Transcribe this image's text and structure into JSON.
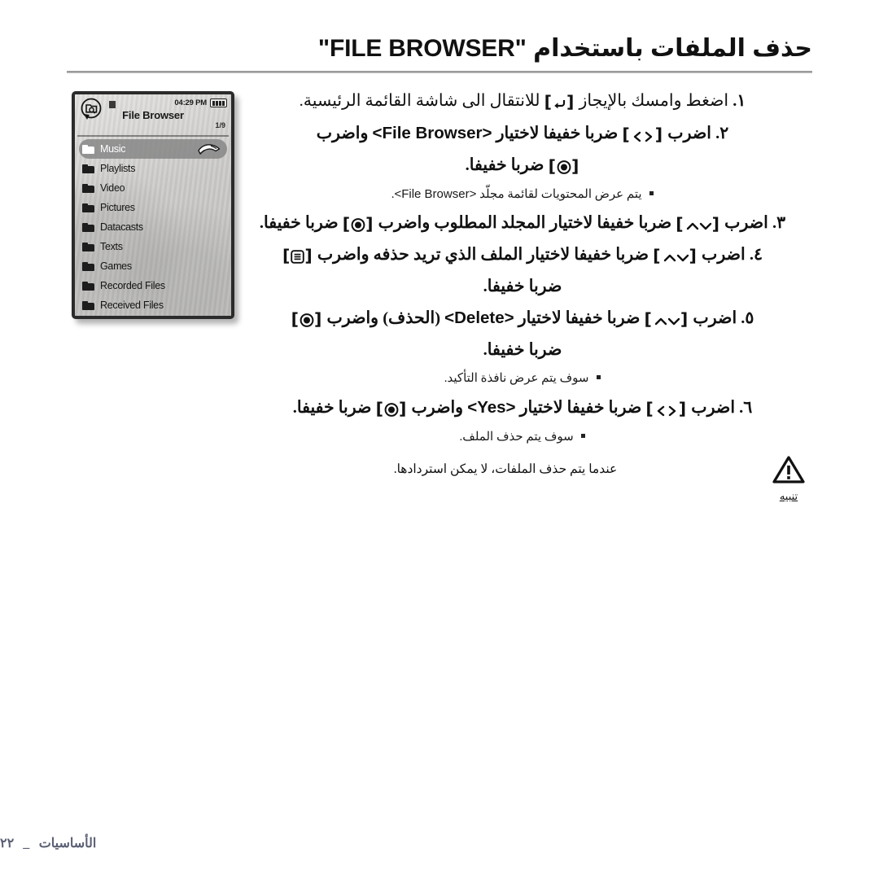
{
  "page": {
    "title": "حذف الملفات باستخدام \"FILE BROWSER\"",
    "direction": "rtl"
  },
  "device": {
    "status": {
      "time": "04:29 PM",
      "battery_icon": "battery-full-icon",
      "badge_icon": "folder-search-badge-icon",
      "marker_icon": "square-marker-icon"
    },
    "screen_title": "File Browser",
    "page_indicator": "1/9",
    "items": [
      {
        "label": "Music",
        "selected": true,
        "icon": "folder-icon",
        "accessory": "hand-pointer-icon"
      },
      {
        "label": "Playlists",
        "selected": false,
        "icon": "folder-icon"
      },
      {
        "label": "Video",
        "selected": false,
        "icon": "folder-icon"
      },
      {
        "label": "Pictures",
        "selected": false,
        "icon": "folder-icon"
      },
      {
        "label": "Datacasts",
        "selected": false,
        "icon": "folder-icon"
      },
      {
        "label": "Texts",
        "selected": false,
        "icon": "folder-icon"
      },
      {
        "label": "Games",
        "selected": false,
        "icon": "folder-icon"
      },
      {
        "label": "Recorded Files",
        "selected": false,
        "icon": "folder-icon"
      },
      {
        "label": "Received Files",
        "selected": false,
        "icon": "folder-icon"
      }
    ]
  },
  "steps": {
    "s1": {
      "number": "١.",
      "before_key": "اضغط وامسك بالإيجاز",
      "key": "return-button-icon",
      "after_key": "للانتقال الى شاشة القائمة الرئيسية."
    },
    "s2": {
      "number": "٢.",
      "part1": "اضرب",
      "key1": "left-right-button-icon",
      "part2": "ضربا خفيفا لاختيار",
      "term": "<File Browser>",
      "part3": "واضرب",
      "key2": "select-button-icon",
      "part4": "ضربا خفيفا."
    },
    "s2_note": {
      "bullet": "square-bullet",
      "text_before": "يتم عرض المحتويات لقائمة مجلّد",
      "term": "<File Browser>",
      "text_after": "."
    },
    "s3": {
      "number": "٣.",
      "part1": "اضرب",
      "key1": "up-down-button-icon",
      "part2": "ضربا خفيفا لاختيار المجلد المطلوب واضرب",
      "key2": "select-button-icon",
      "part3": "ضربا خفيفا."
    },
    "s4": {
      "number": "٤.",
      "part1": "اضرب",
      "key1": "up-down-button-icon",
      "part2": "ضربا خفيفا لاختيار الملف الذي تريد حذفه واضرب",
      "key2": "menu-button-icon",
      "part3": "ضربا خفيفا."
    },
    "s5": {
      "number": "٥.",
      "part1": "اضرب",
      "key1": "up-down-button-icon",
      "part2": "ضربا خفيفا لاختيار",
      "term": "<Delete>",
      "part3": "(الحذف) واضرب",
      "key2": "select-button-icon",
      "part4": "ضربا خفيفا."
    },
    "s5_note": {
      "bullet": "square-bullet",
      "text": "سوف يتم عرض نافذة التأكيد."
    },
    "s6": {
      "number": "٦.",
      "part1": "اضرب",
      "key1": "left-right-button-icon",
      "part2": "ضربا خفيفا لاختيار",
      "term": "<Yes>",
      "part3": "واضرب",
      "key2": "select-button-icon",
      "part4": "ضربا خفيفا."
    },
    "s6_note": {
      "bullet": "square-bullet",
      "text": "سوف يتم حذف الملف."
    }
  },
  "caution": {
    "icon": "warning-triangle-icon",
    "label": "تنبيه",
    "bullet": "square-bullet",
    "text": "عندما يتم حذف الملفات، لا يمكن استردادها."
  },
  "footer": {
    "page_number": "٢٢",
    "separator": "_",
    "section": "الأساسيات",
    "color": "#5b5f74"
  },
  "colors": {
    "text": "#111111",
    "rule": "#9b9b9b",
    "device_bezel": "#2b2b2b",
    "selection": "#848484",
    "footer": "#5b5f74"
  }
}
